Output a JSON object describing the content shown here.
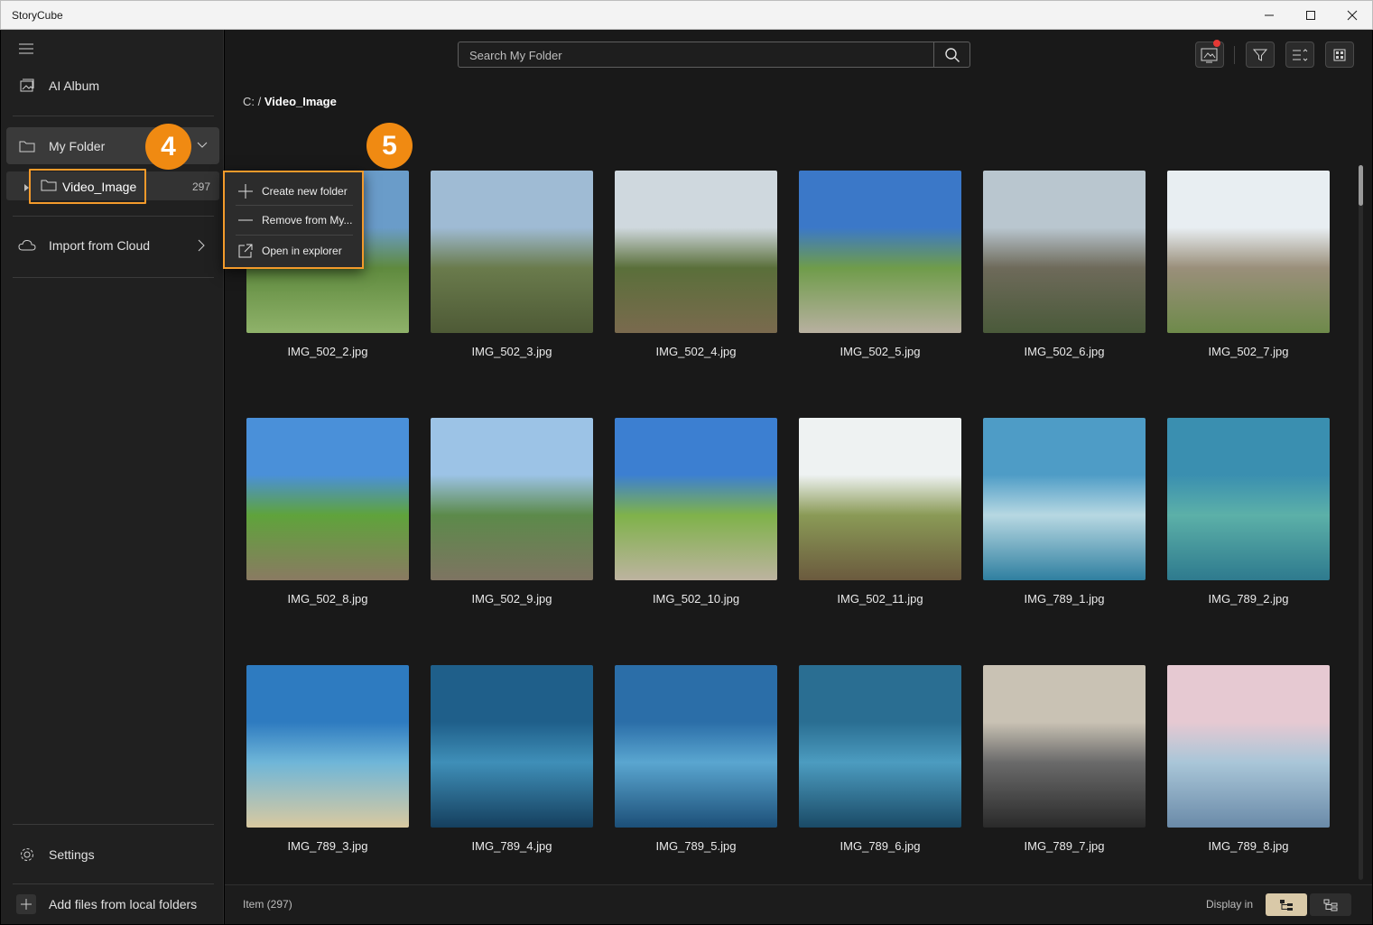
{
  "window": {
    "title": "StoryCube"
  },
  "sidebar": {
    "ai_album": "AI Album",
    "my_folder": "My Folder",
    "folder": {
      "name": "Video_Image",
      "count": "297"
    },
    "import_cloud": "Import from Cloud",
    "settings": "Settings",
    "add_files": "Add files from local folders"
  },
  "search": {
    "placeholder": "Search My Folder"
  },
  "breadcrumb": {
    "root": "C:",
    "separator": "/",
    "current": "Video_Image"
  },
  "context_menu": {
    "items": [
      "Create new folder",
      "Remove from My...",
      "Open in explorer"
    ]
  },
  "badges": {
    "step4": "4",
    "step5": "5"
  },
  "files": [
    "IMG_502_2.jpg",
    "IMG_502_3.jpg",
    "IMG_502_4.jpg",
    "IMG_502_5.jpg",
    "IMG_502_6.jpg",
    "IMG_502_7.jpg",
    "IMG_502_8.jpg",
    "IMG_502_9.jpg",
    "IMG_502_10.jpg",
    "IMG_502_11.jpg",
    "IMG_789_1.jpg",
    "IMG_789_2.jpg",
    "IMG_789_3.jpg",
    "IMG_789_4.jpg",
    "IMG_789_5.jpg",
    "IMG_789_6.jpg",
    "IMG_789_7.jpg",
    "IMG_789_8.jpg"
  ],
  "footer": {
    "item_count": "Item (297)",
    "display_in": "Display in"
  },
  "colors": {
    "accent": "#f08a12",
    "highlight": "#f39a2b",
    "notification": "#e53935"
  }
}
